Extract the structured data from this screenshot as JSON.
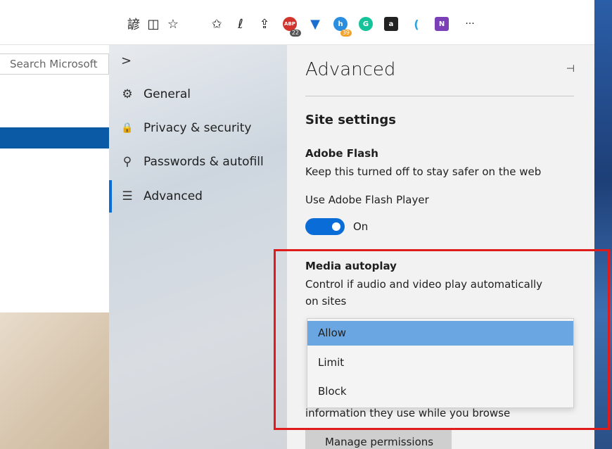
{
  "toolbar": {
    "icons": [
      {
        "name": "reading-view-icon",
        "glyph": "諺"
      },
      {
        "name": "book-icon",
        "glyph": "◫"
      },
      {
        "name": "favorite-star-icon",
        "glyph": "☆"
      },
      {
        "name": "favorites-list-icon",
        "glyph": "✩"
      },
      {
        "name": "pen-icon",
        "glyph": "ℓ"
      },
      {
        "name": "share-icon",
        "glyph": "⇪"
      }
    ],
    "extensions": [
      {
        "name": "adblock-extension-icon",
        "label": "ABP",
        "color": "#d0342c",
        "badge": "22",
        "badge_color": "#555555"
      },
      {
        "name": "trophy-extension-icon",
        "label": "▼",
        "color": "#1c6fd1",
        "badge": "",
        "badge_color": ""
      },
      {
        "name": "honey-extension-icon",
        "label": "h",
        "color": "#2a8de0",
        "badge": "39",
        "badge_color": "#f0a22a"
      },
      {
        "name": "grammarly-extension-icon",
        "label": "G",
        "color": "#15c39a",
        "badge": "",
        "badge_color": ""
      },
      {
        "name": "amazon-extension-icon",
        "label": "a",
        "color": "#222222",
        "badge": "",
        "badge_color": ""
      },
      {
        "name": "mic-extension-icon",
        "label": "(",
        "color": "#2aa2e0",
        "badge": "",
        "badge_color": ""
      },
      {
        "name": "onenote-extension-icon",
        "label": "N",
        "color": "#7b3fb8",
        "badge": "",
        "badge_color": ""
      }
    ],
    "more_glyph": "···"
  },
  "page": {
    "search_placeholder": "Search Microsoft"
  },
  "nav": {
    "back_glyph": ">",
    "items": [
      {
        "label": "General",
        "glyph": "⚙"
      },
      {
        "label": "Privacy & security",
        "glyph": "🔒"
      },
      {
        "label": "Passwords & autofill",
        "glyph": "⚲"
      },
      {
        "label": "Advanced",
        "glyph": "☰"
      }
    ],
    "active": "Advanced"
  },
  "panel": {
    "title": "Advanced",
    "pin_glyph": "⊣",
    "section_title": "Site settings",
    "flash": {
      "title": "Adobe Flash",
      "description": "Keep this turned off to stay safer on the web",
      "toggle_label": "Use Adobe Flash Player",
      "toggle_state": "On"
    },
    "autoplay": {
      "title": "Media autoplay",
      "description_line1": "Control if audio and video play automatically",
      "description_line2": "on sites",
      "options": [
        "Allow",
        "Limit",
        "Block"
      ],
      "selected": "Allow"
    },
    "info_text": "information they use while you browse",
    "manage_button": "Manage permissions"
  },
  "colors": {
    "accent": "#0a6cd6",
    "highlight": "#e01b1b",
    "selected_option": "#69a6e2"
  }
}
